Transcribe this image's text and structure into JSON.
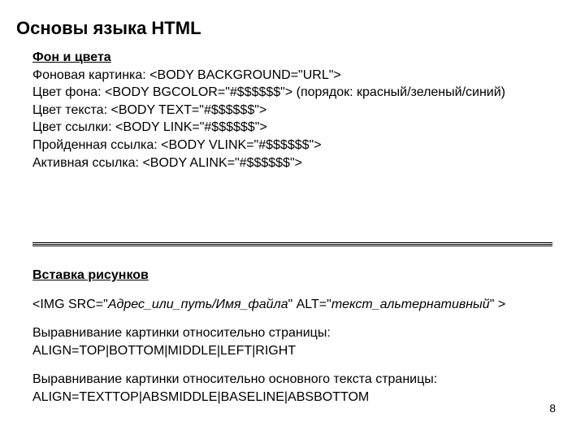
{
  "title": "Основы языка HTML",
  "sec1": {
    "heading": "Фон и цвета",
    "line1_label": "Фоновая картинка: ",
    "line1_code": "<BODY BACKGROUND=\"URL\">",
    "line2_label": "Цвет фона: ",
    "line2_code": "<BODY BGCOLOR=\"#$$$$$$\">",
    "line2_note": " (порядок: красный/зеленый/синий)",
    "line3_label": "Цвет текста: ",
    "line3_code": "<BODY TEXT=\"#$$$$$$\">",
    "line4_label": "Цвет ссылки: ",
    "line4_code": "<BODY LINK=\"#$$$$$$\">",
    "line5_label": "Пройденная ссылка: ",
    "line5_code": "<BODY VLINK=\"#$$$$$$\">",
    "line6_label": "Активная ссылка: ",
    "line6_code": "<BODY ALINK=\"#$$$$$$\">"
  },
  "sec2": {
    "heading": "Вставка рисунков",
    "img_open": "<IMG SRC=\"",
    "img_src_ital": "Адрес_или_путь/Имя_файла",
    "img_mid": "\" ALT=\"",
    "img_alt_ital": "текст_альтернативный",
    "img_close": "\" >",
    "align1_a": "Выравнивание картинки относительно страницы:",
    "align1_b": "ALIGN=TOP|BOTTOM|MIDDLE|LEFT|RIGHT",
    "align2_a": "Выравнивание картинки относительно основного текста страницы:",
    "align2_b": "ALIGN=TEXTTOP|ABSMIDDLE|BASELINE|ABSBOTTOM"
  },
  "page": "8"
}
